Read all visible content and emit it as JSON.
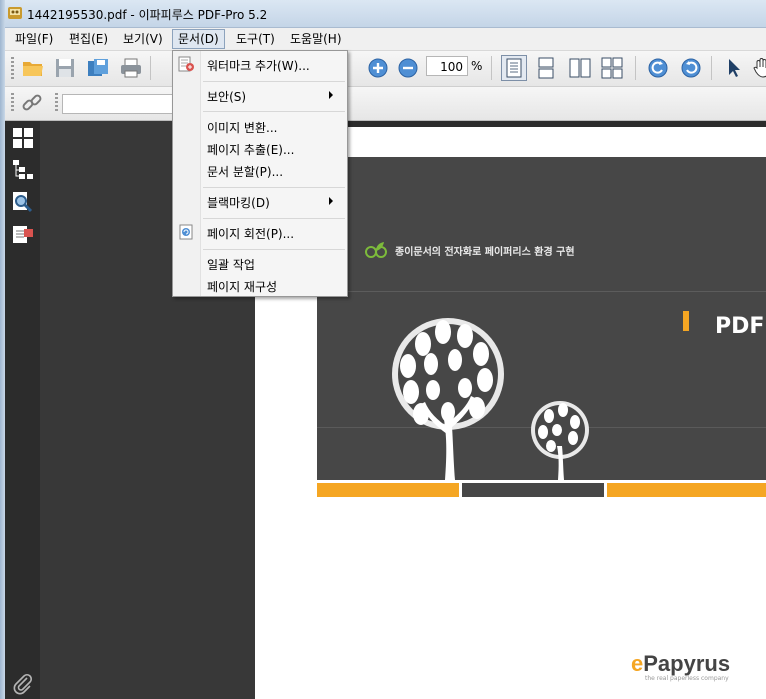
{
  "window": {
    "title": "1442195530.pdf - 이파피루스 PDF-Pro 5.2"
  },
  "menubar": {
    "items": [
      "파일(F)",
      "편집(E)",
      "보기(V)",
      "문서(D)",
      "도구(T)",
      "도움말(H)"
    ],
    "active": "문서(D)"
  },
  "toolbar": {
    "zoom_value": "100",
    "zoom_unit": "%"
  },
  "document_menu": {
    "items": [
      {
        "label": "워터마크 추가(W)...",
        "icon": "watermark-icon"
      },
      {
        "label": "보안(S)",
        "submenu": true
      },
      {
        "label": "이미지 변환..."
      },
      {
        "label": "페이지 추출(E)..."
      },
      {
        "label": "문서 분할(P)..."
      },
      {
        "label": "블랙마킹(D)",
        "submenu": true
      },
      {
        "label": "페이지 회전(P)...",
        "icon": "rotate-page-icon"
      },
      {
        "label": "일괄 작업"
      },
      {
        "label": "페이지 재구성"
      }
    ]
  },
  "document": {
    "tagline": "종이문서의 전자화로 페이퍼리스 환경 구현",
    "heading": "PDF",
    "logo": "ePapyrus",
    "logo_sub": "the real paperless company",
    "colors": {
      "header_bg": "#474747",
      "accent": "#f5a623",
      "green": "#7dbb3b"
    }
  }
}
